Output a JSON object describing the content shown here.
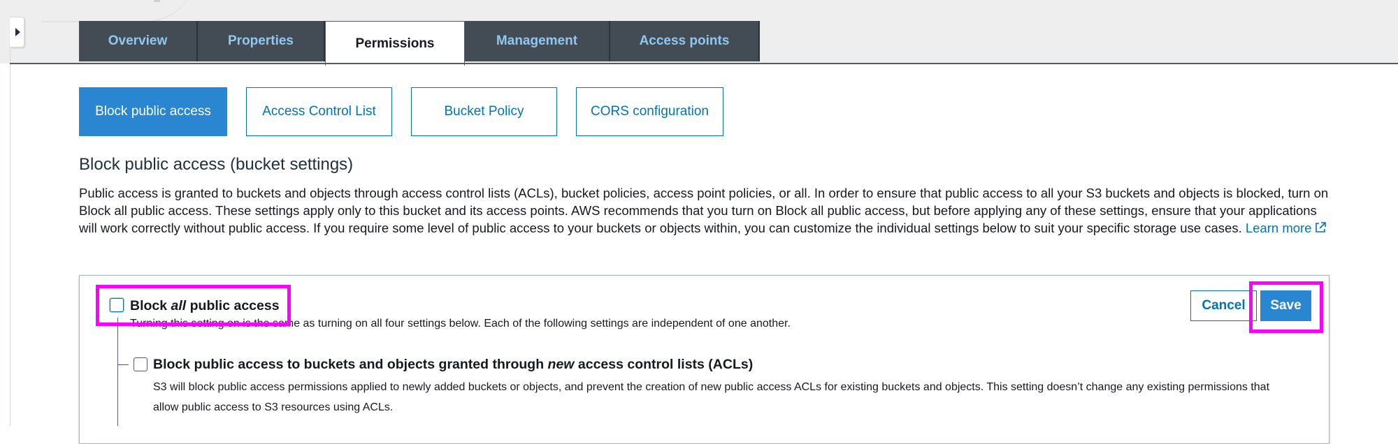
{
  "tabs": [
    {
      "label": "Overview"
    },
    {
      "label": "Properties"
    },
    {
      "label": "Permissions"
    },
    {
      "label": "Management"
    },
    {
      "label": "Access points"
    }
  ],
  "subtabs": [
    {
      "label": "Block public access"
    },
    {
      "label": "Access Control List"
    },
    {
      "label": "Bucket Policy"
    },
    {
      "label": "CORS configuration"
    }
  ],
  "section": {
    "title": "Block public access (bucket settings)",
    "description": "Public access is granted to buckets and objects through access control lists (ACLs), bucket policies, access point policies, or all. In order to ensure that public access to all your S3 buckets and objects is blocked, turn on Block all public access. These settings apply only to this bucket and its access points. AWS recommends that you turn on Block all public access, but before applying any of these settings, ensure that your applications will work correctly without public access. If you require some level of public access to your buckets or objects within, you can customize the individual settings below to suit your specific storage use cases.",
    "learn_more": "Learn more"
  },
  "panel": {
    "block_all": {
      "prefix": "Block ",
      "emph": "all",
      "suffix": " public access",
      "description": "Turning this setting on is the same as turning on all four settings below. Each of the following settings are independent of one another."
    },
    "block_new_acl": {
      "prefix": "Block public access to buckets and objects granted through ",
      "emph": "new",
      "suffix": " access control lists (ACLs)",
      "description": "S3 will block public access permissions applied to newly added buckets or objects, and prevent the creation of new public access ACLs for existing buckets and objects. This setting doesn’t change any existing permissions that allow public access to S3 resources using ACLs."
    },
    "cancel_label": "Cancel",
    "save_label": "Save"
  },
  "colors": {
    "highlight": "#ff00ff",
    "primary": "#2a86d1",
    "link": "#0073bb",
    "tab_bg": "#434c54",
    "tab_text": "#8fc8f0"
  },
  "icons": {
    "sidebar_toggle": "caret-right-icon",
    "learn_more": "external-link-icon"
  }
}
